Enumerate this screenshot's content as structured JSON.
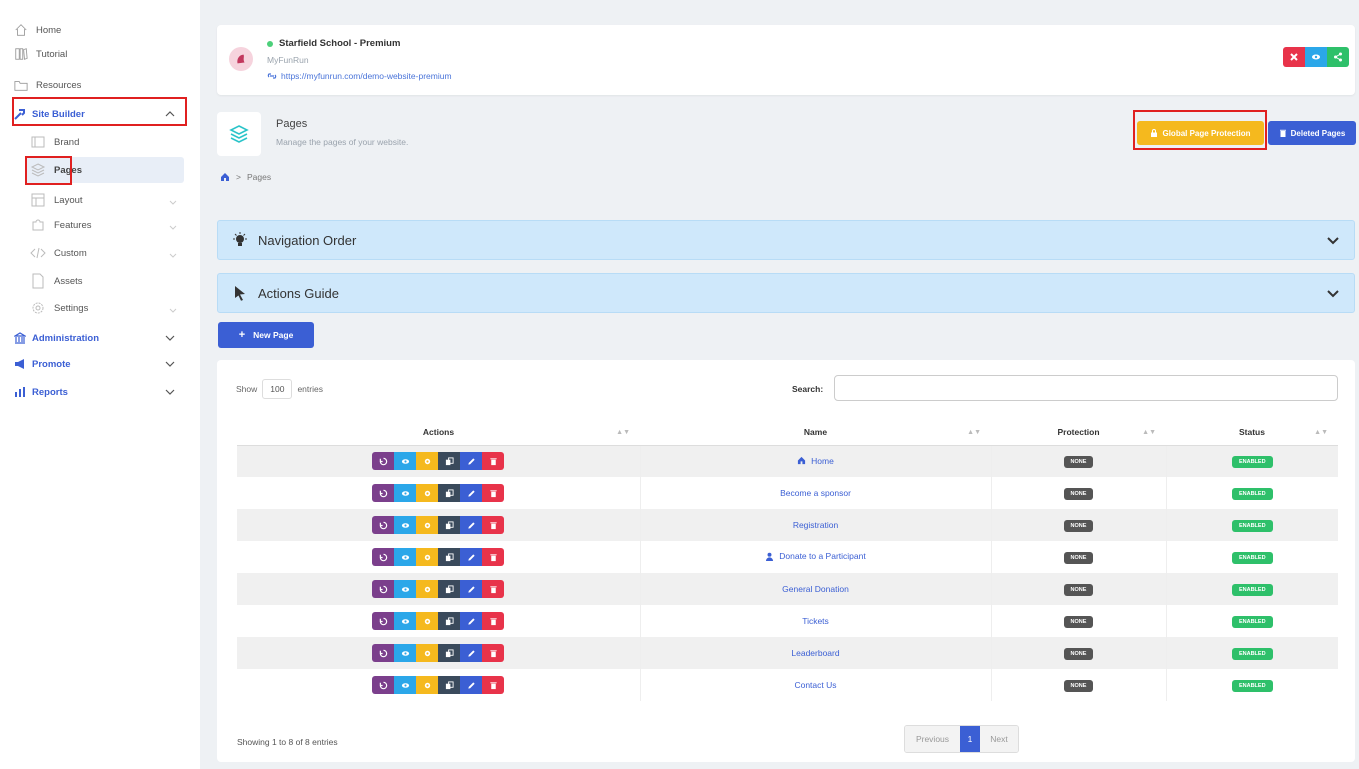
{
  "sidebar": {
    "top_items": [
      {
        "label": "Home",
        "icon": "home-icon"
      },
      {
        "label": "Tutorial",
        "icon": "book-icon"
      },
      {
        "label": "Resources",
        "icon": "folder-icon"
      }
    ],
    "site_builder": {
      "label": "Site Builder",
      "icon": "hammer-icon",
      "items": [
        {
          "label": "Brand",
          "icon": "brand-icon"
        },
        {
          "label": "Pages",
          "icon": "layers-icon"
        },
        {
          "label": "Layout",
          "icon": "layout-icon"
        },
        {
          "label": "Features",
          "icon": "puzzle-icon"
        },
        {
          "label": "Custom",
          "icon": "code-icon"
        },
        {
          "label": "Assets",
          "icon": "file-icon"
        },
        {
          "label": "Settings",
          "icon": "gear-icon"
        }
      ]
    },
    "sections": [
      {
        "label": "Administration",
        "icon": "bank-icon"
      },
      {
        "label": "Promote",
        "icon": "megaphone-icon"
      },
      {
        "label": "Reports",
        "icon": "chart-icon"
      }
    ]
  },
  "header": {
    "site_name": "Starfield School - Premium",
    "site_subtitle": "MyFunRun",
    "site_url": "https://myfunrun.com/demo-website-premium",
    "status_color": "#4cd07a"
  },
  "page": {
    "title": "Pages",
    "description": "Manage the pages of your website.",
    "global_protection_label": "Global Page Protection",
    "deleted_pages_label": "Deleted Pages",
    "breadcrumb": "Pages"
  },
  "accordions": {
    "navigation_order": "Navigation Order",
    "actions_guide": "Actions Guide"
  },
  "new_page_label": "New Page",
  "table": {
    "show_label": "Show",
    "entries_value": "100",
    "entries_label": "entries",
    "search_label": "Search:",
    "columns": {
      "actions": "Actions",
      "name": "Name",
      "protection": "Protection",
      "status": "Status"
    },
    "rows": [
      {
        "name": "Home",
        "icon": "home-icon",
        "protection": "NONE",
        "status": "ENABLED"
      },
      {
        "name": "Become a sponsor",
        "icon": "",
        "protection": "NONE",
        "status": "ENABLED"
      },
      {
        "name": "Registration",
        "icon": "",
        "protection": "NONE",
        "status": "ENABLED"
      },
      {
        "name": "Donate to a Participant",
        "icon": "user-icon",
        "protection": "NONE",
        "status": "ENABLED"
      },
      {
        "name": "General Donation",
        "icon": "",
        "protection": "NONE",
        "status": "ENABLED"
      },
      {
        "name": "Tickets",
        "icon": "",
        "protection": "NONE",
        "status": "ENABLED"
      },
      {
        "name": "Leaderboard",
        "icon": "",
        "protection": "NONE",
        "status": "ENABLED"
      },
      {
        "name": "Contact Us",
        "icon": "",
        "protection": "NONE",
        "status": "ENABLED"
      }
    ],
    "footer": "Showing 1 to 8 of 8 entries",
    "pagination": {
      "previous": "Previous",
      "current": "1",
      "next": "Next"
    }
  },
  "colors": {
    "accent": "#3b5fd4",
    "warning": "#f5b91e",
    "success": "#2ec06a",
    "danger": "#e8334a",
    "highlight_box": "#e02020"
  }
}
